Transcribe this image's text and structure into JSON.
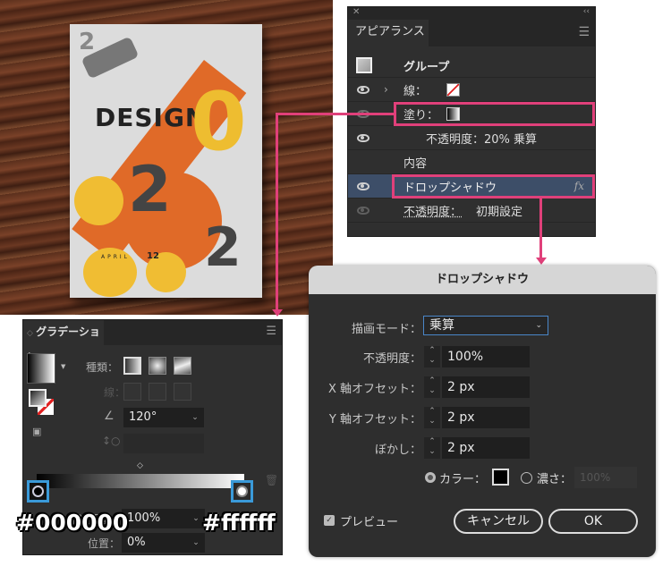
{
  "poster": {
    "title": "DESIGN",
    "digits": [
      "2",
      "0",
      "2",
      "2"
    ],
    "small_digit": "2",
    "date_label": "APRIL",
    "date_num": "12"
  },
  "appearance": {
    "title": "アピアランス",
    "rows": {
      "group": "グループ",
      "stroke": "線：",
      "fill": "塗り：",
      "opacity_fill": "不透明度：20% 乗算",
      "contents": "内容",
      "drop_shadow": "ドロップシャドウ",
      "fx": "fx",
      "opacity_label": "不透明度：",
      "opacity_value": "初期設定"
    }
  },
  "gradient": {
    "title": "グラデーション",
    "type_label": "種類：",
    "stroke_label": "線：",
    "angle": "120°",
    "opacity_label": "不透明度：",
    "opacity": "100%",
    "position_label": "位置：",
    "position": "0%",
    "stop_left_color": "#000000",
    "stop_right_color": "#ffffff",
    "hex_left": "#000000",
    "hex_right": "#ffffff"
  },
  "dialog": {
    "title": "ドロップシャドウ",
    "mode_label": "描画モード：",
    "mode": "乗算",
    "opacity_label": "不透明度：",
    "opacity": "100%",
    "x_label": "X 軸オフセット：",
    "x": "2 px",
    "y_label": "Y 軸オフセット：",
    "y": "2 px",
    "blur_label": "ぼかし：",
    "blur": "2 px",
    "color_label": "カラー：",
    "darkness_label": "濃さ：",
    "darkness": "100%",
    "preview_label": "プレビュー",
    "cancel": "キャンセル",
    "ok": "OK"
  },
  "colors": {
    "highlight": "#e0407a",
    "callout": "#3a9ad9"
  }
}
